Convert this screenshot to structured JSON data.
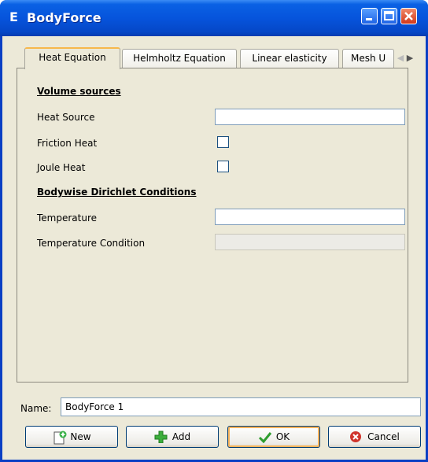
{
  "window": {
    "title": "BodyForce",
    "app_icon_letter": "E"
  },
  "tabs": [
    {
      "label": "Heat Equation",
      "active": true
    },
    {
      "label": "Helmholtz Equation",
      "active": false
    },
    {
      "label": "Linear elasticity",
      "active": false
    },
    {
      "label": "Mesh U",
      "active": false
    }
  ],
  "tab_scroll": {
    "left": "◀",
    "right": "▶"
  },
  "form": {
    "section_volume": "Volume sources",
    "heat_source_label": "Heat Source",
    "heat_source_value": "",
    "friction_heat_label": "Friction Heat",
    "friction_heat_checked": false,
    "joule_heat_label": "Joule Heat",
    "joule_heat_checked": false,
    "section_dirichlet": "Bodywise Dirichlet Conditions",
    "temperature_label": "Temperature",
    "temperature_value": "",
    "temperature_condition_label": "Temperature Condition",
    "temperature_condition_value": ""
  },
  "name": {
    "label": "Name:",
    "value": "BodyForce 1"
  },
  "buttons": {
    "new": "New",
    "add": "Add",
    "ok": "OK",
    "cancel": "Cancel"
  },
  "colors": {
    "titlebar": "#0654dc",
    "window_bg": "#ece9d8",
    "tab_active_accent": "#f7b84c"
  }
}
